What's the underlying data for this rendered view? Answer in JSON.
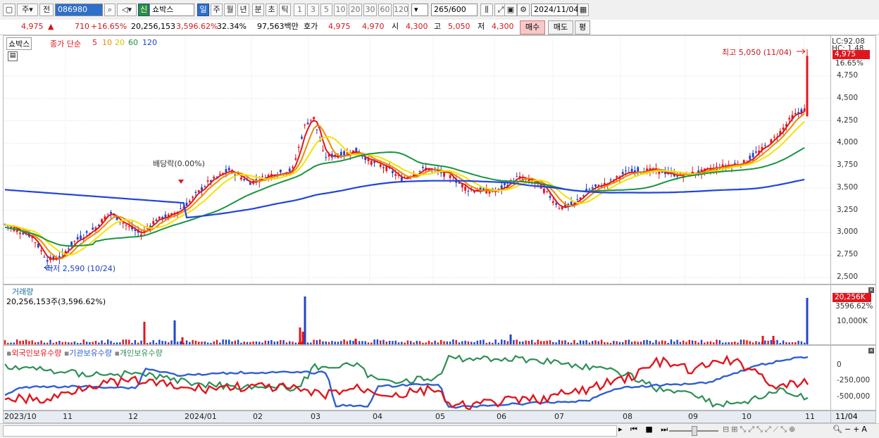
{
  "toolbar": {
    "tab1": "주",
    "tab2": "전",
    "code": "086980",
    "stock_tag": "신",
    "stock_name": "쇼박스",
    "periods": [
      "일",
      "주",
      "월",
      "년",
      "분",
      "초",
      "틱"
    ],
    "period_selected": "일",
    "intervals": [
      "1",
      "3",
      "5",
      "10",
      "20",
      "30",
      "60",
      "120"
    ],
    "count": "265",
    "count_total": "/600",
    "date": "2024/11/04"
  },
  "infobar": {
    "price": "4,975",
    "change": "710",
    "change_pct": "+16.65%",
    "volume": "20,256,153",
    "volume_pct": "3,596.62%",
    "turnover": "32.34%",
    "amount": "97,563백만",
    "quote_label": "호가",
    "ask": "4,975",
    "bid": "4,970",
    "open_label": "시",
    "open": "4,300",
    "high_label": "고",
    "high": "5,050",
    "low_label": "저",
    "low": "4,300",
    "buy": "매수",
    "sell": "매도",
    "eval": "평"
  },
  "price_pane": {
    "title": "쇼박스",
    "ma_label": "종가 단순",
    "ma": [
      {
        "period": "5",
        "color": "#e0161e"
      },
      {
        "period": "10",
        "color": "#ee8a00"
      },
      {
        "period": "20",
        "color": "#f4e200"
      },
      {
        "period": "60",
        "color": "#1b9440"
      },
      {
        "period": "120",
        "color": "#2244dd"
      }
    ],
    "high_annot": "최고 5,050 (11/04)",
    "low_annot": "최저 2,590 (10/24)",
    "div_annot": "배당락(0.00%)",
    "lc": "LC:92.08",
    "hc": "HC: 1.48",
    "last_price": "4,975",
    "last_pct": "16.65%",
    "y_ticks": [
      "4,750",
      "4,500",
      "4,250",
      "4,000",
      "3,750",
      "3,500",
      "3,250",
      "3,000",
      "2,750",
      "2,500"
    ]
  },
  "volume_pane": {
    "title": "거래량",
    "summary": "20,256,153주(3,596.62%)",
    "last": "20,256K",
    "last_pct": "3596.62%",
    "y_tick": "10,000K"
  },
  "holders_pane": {
    "series": [
      {
        "name": "외국인보유수량",
        "color": "#e0161e"
      },
      {
        "name": "기관보유수량",
        "color": "#2f5fd0"
      },
      {
        "name": "개인보유수량",
        "color": "#2e8f55"
      }
    ],
    "y_ticks": [
      "0",
      "-250,000",
      "-500,000"
    ]
  },
  "x_axis": {
    "labels": [
      "2023/10",
      "11",
      "12",
      "2024/01",
      "02",
      "03",
      "04",
      "05",
      "06",
      "07",
      "08",
      "09",
      "10",
      "11"
    ],
    "right_label": "11/04"
  },
  "chart_data": {
    "type": "candlestick",
    "title": "쇼박스",
    "ylim": [
      2450,
      5100
    ],
    "key_points": [
      {
        "date": "2023/10/24",
        "price": 2590,
        "label": "최저"
      },
      {
        "date": "2024/11/04",
        "price": 5050,
        "label": "최고"
      }
    ],
    "ma_series_end": {
      "ma5": 4380,
      "ma10": 4330,
      "ma20": 4150,
      "ma60": 3850,
      "ma120": 3690
    }
  }
}
